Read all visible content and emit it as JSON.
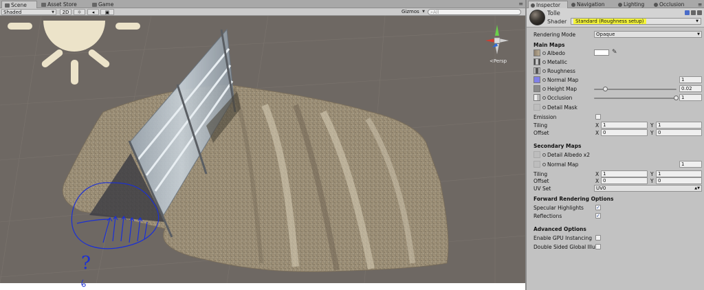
{
  "scene_tabs": [
    {
      "label": "Scene"
    },
    {
      "label": "Asset Store"
    },
    {
      "label": "Game"
    }
  ],
  "toolbar": {
    "shading": "Shaded",
    "mode_2d": "2D",
    "gizmos": "Gizmos",
    "search_placeholder": "All"
  },
  "viewport": {
    "projection": "Persp",
    "annotation_mark": "?"
  },
  "inspector_tabs": [
    {
      "label": "Inspector"
    },
    {
      "label": "Navigation"
    },
    {
      "label": "Lighting"
    },
    {
      "label": "Occlusion"
    }
  ],
  "material": {
    "name": "Tolle",
    "shader_label": "Shader",
    "shader_value": "Standard (Roughness setup)"
  },
  "rendering_mode": {
    "label": "Rendering Mode",
    "value": "Opaque"
  },
  "main_maps": {
    "header": "Main Maps",
    "albedo": "Albedo",
    "metallic": "Metallic",
    "roughness": "Roughness",
    "normal_map": "Normal Map",
    "normal_value": "1",
    "height_map": "Height Map",
    "height_value": "0.02",
    "height_slider": 0.11,
    "occlusion": "Occlusion",
    "occlusion_value": "1",
    "occlusion_slider": 1.0,
    "detail_mask": "Detail Mask",
    "emission": "Emission",
    "tiling": "Tiling",
    "tiling_x": "1",
    "tiling_y": "1",
    "offset": "Offset",
    "offset_x": "0",
    "offset_y": "0"
  },
  "secondary_maps": {
    "header": "Secondary Maps",
    "detail_albedo": "Detail Albedo x2",
    "normal_map": "Normal Map",
    "normal_value": "1",
    "tiling": "Tiling",
    "tiling_x": "1",
    "tiling_y": "1",
    "offset": "Offset",
    "offset_x": "0",
    "offset_y": "0",
    "uv_set_label": "UV Set",
    "uv_set_value": "UV0"
  },
  "axis_labels": {
    "x": "X",
    "y": "Y"
  },
  "forward": {
    "header": "Forward Rendering Options",
    "specular": "Specular Highlights",
    "specular_checked": true,
    "reflections": "Reflections",
    "reflections_checked": true
  },
  "advanced": {
    "header": "Advanced Options",
    "gpu_instancing": "Enable GPU Instancing",
    "gpu_checked": false,
    "double_sided": "Double Sided Global Illu",
    "double_checked": false
  },
  "colors": {
    "viewport_bg": "#6e6863",
    "highlight": "#f5f53a",
    "annotation_ink": "#1a2fd6",
    "sun": "#ece3c9"
  }
}
